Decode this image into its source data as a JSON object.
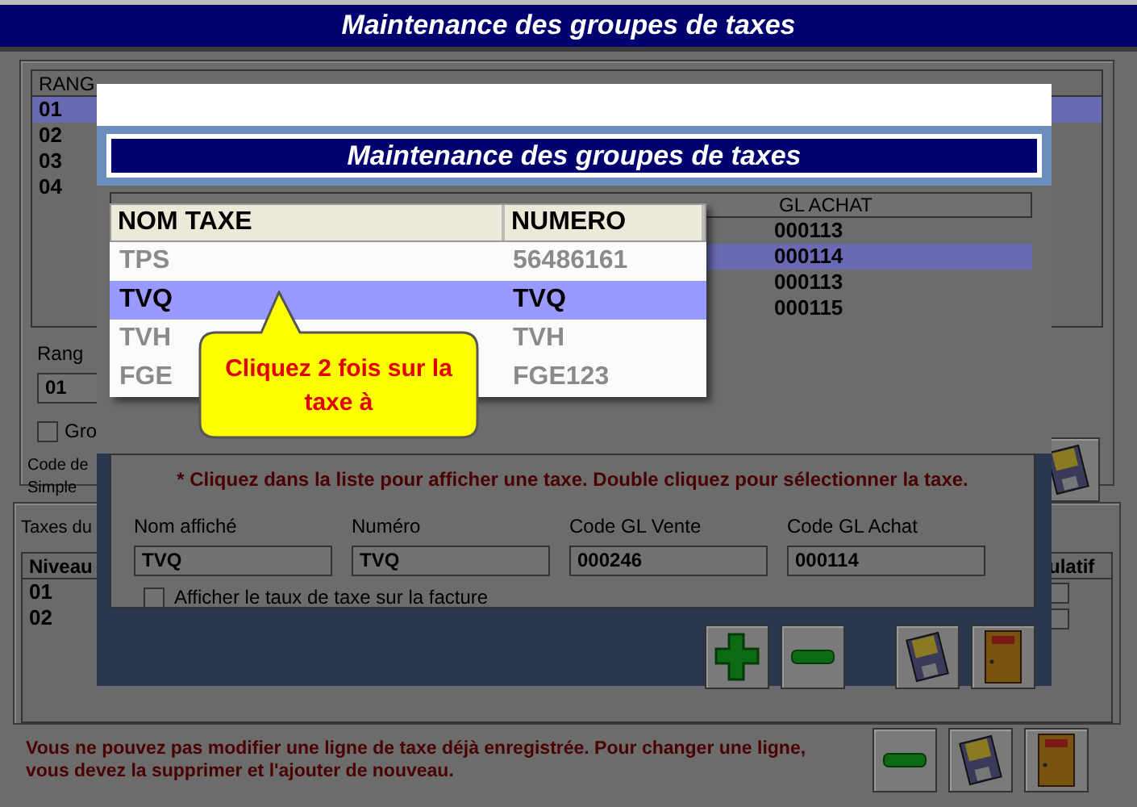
{
  "window": {
    "title": "Maintenance des groupes de taxes"
  },
  "groups_table": {
    "columns": [
      "RANG"
    ],
    "rows": [
      {
        "rang": "01",
        "selected": true
      },
      {
        "rang": "02",
        "selected": false
      },
      {
        "rang": "03",
        "selected": false
      },
      {
        "rang": "04",
        "selected": false
      }
    ]
  },
  "group_form": {
    "rang_label": "Rang",
    "rang_value": "01",
    "checkbox_label": "Gro",
    "checked": false,
    "code_text": "Code de\nSimple",
    "button": {
      "kind": "save"
    }
  },
  "taxes_section": {
    "title": "Taxes du",
    "columns": [
      "Niveau",
      "ulatif"
    ],
    "rows": [
      {
        "niveau": "01",
        "checked": false
      },
      {
        "niveau": "02",
        "checked": false
      }
    ]
  },
  "warning": "Vous ne pouvez pas modifier une ligne de taxe déjà enregistrée. Pour changer une ligne,\nvous devez la supprimer et l'ajouter de nouveau.",
  "bottom_buttons": [
    {
      "kind": "remove"
    },
    {
      "kind": "save"
    },
    {
      "kind": "exit"
    }
  ],
  "dialog": {
    "title": "Maintenance des groupes de taxes",
    "table": {
      "columns": [
        "GL ACHAT"
      ],
      "rows": [
        {
          "gl_achat": "000113",
          "selected": false
        },
        {
          "gl_achat": "000114",
          "selected": true
        },
        {
          "gl_achat": "000113",
          "selected": false
        },
        {
          "gl_achat": "000115",
          "selected": false
        }
      ]
    },
    "picker": {
      "columns": [
        "NOM TAXE",
        "NUMERO"
      ],
      "rows": [
        {
          "nom": "TPS",
          "numero": "56486161",
          "selected": false,
          "faded": true
        },
        {
          "nom": "TVQ",
          "numero": "TVQ",
          "selected": true,
          "faded": false
        },
        {
          "nom": "TVH",
          "numero": "TVH",
          "selected": false,
          "faded": true
        },
        {
          "nom": "FGE",
          "numero": "FGE123",
          "selected": false,
          "faded": true
        }
      ]
    },
    "tooltip": "Cliquez 2 fois sur la taxe à",
    "hint": "* Cliquez dans la liste pour afficher une taxe. Double cliquez pour sélectionner la taxe.",
    "fields": [
      {
        "label": "Nom affiché",
        "value": "TVQ"
      },
      {
        "label": "Numéro",
        "value": "TVQ"
      },
      {
        "label": "Code GL Vente",
        "value": "000246"
      },
      {
        "label": "Code GL Achat",
        "value": "000114"
      }
    ],
    "checkbox": {
      "label": "Afficher le taux de taxe sur la facture",
      "checked": false
    },
    "buttons": [
      {
        "kind": "add"
      },
      {
        "kind": "remove"
      },
      {
        "kind": "save"
      },
      {
        "kind": "exit"
      }
    ]
  }
}
